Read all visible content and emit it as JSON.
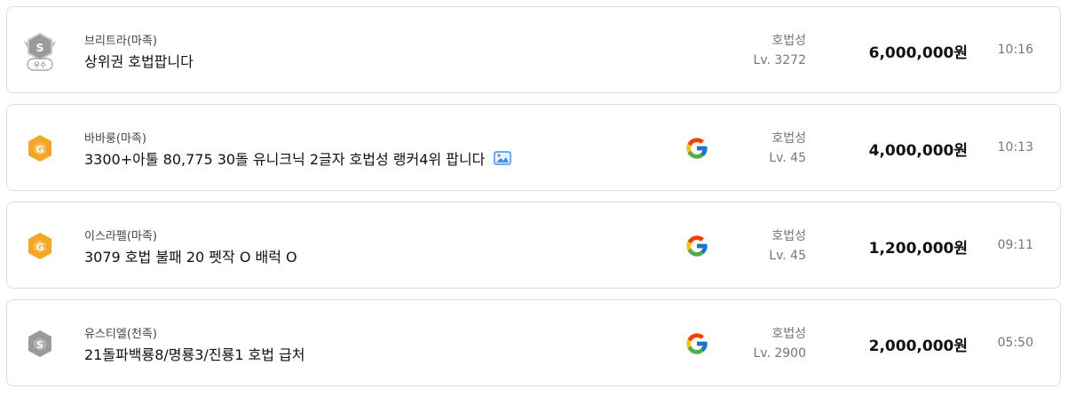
{
  "listings": [
    {
      "badge": "silver-wings-excellent-badge",
      "badge_text": "우수",
      "server": "브리트라(마족)",
      "title": "상위권 호법팝니다",
      "has_image": false,
      "google": false,
      "stat_label": "호법성",
      "level": "Lv. 3272",
      "price": "6,000,000원",
      "time": "10:16"
    },
    {
      "badge": "gold-hexagon-badge",
      "server": "바바룽(마족)",
      "title": "3300+아툴 80,775 30돌 유니크닉 2글자 호법성 랭커4위 팝니다",
      "has_image": true,
      "google": true,
      "stat_label": "호법성",
      "level": "Lv. 45",
      "price": "4,000,000원",
      "time": "10:13"
    },
    {
      "badge": "gold-hexagon-badge",
      "server": "이스라펠(마족)",
      "title": "3079 호법 불패 20 펫작 O 배럭 O",
      "has_image": false,
      "google": true,
      "stat_label": "호법성",
      "level": "Lv. 45",
      "price": "1,200,000원",
      "time": "09:11"
    },
    {
      "badge": "silver-hexagon-badge",
      "server": "유스티엘(천족)",
      "title": "21돌파백룡8/명룡3/진룡1 호법 급처",
      "has_image": false,
      "google": true,
      "stat_label": "호법성",
      "level": "Lv. 2900",
      "price": "2,000,000원",
      "time": "05:50"
    }
  ]
}
